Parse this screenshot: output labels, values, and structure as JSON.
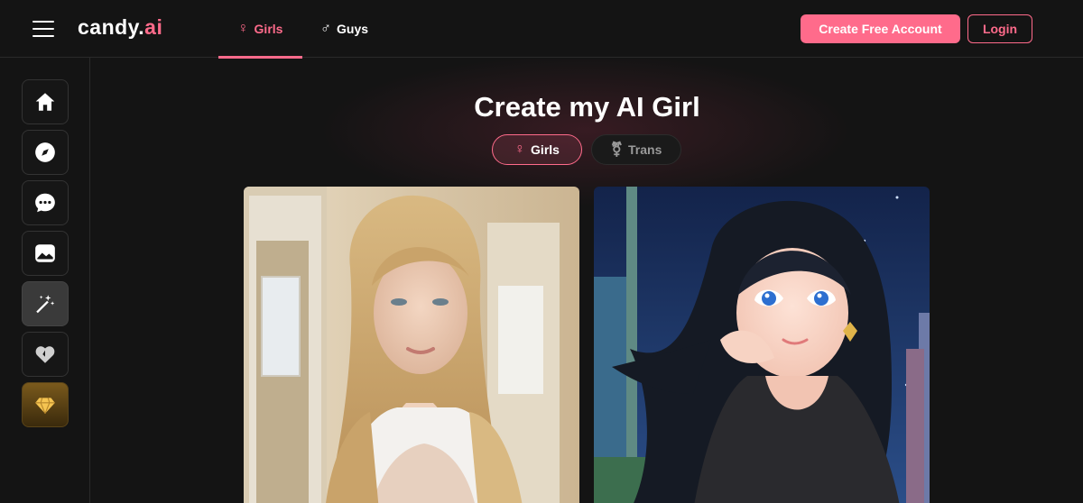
{
  "header": {
    "logo_prefix": "candy.",
    "logo_suffix": "ai",
    "tabs": [
      {
        "label": "Girls",
        "icon": "female-icon",
        "active": true
      },
      {
        "label": "Guys",
        "icon": "male-icon",
        "active": false
      }
    ],
    "create_account_label": "Create Free Account",
    "login_label": "Login",
    "accent_color": "#ff6b8b"
  },
  "sidebar": {
    "items": [
      {
        "name": "home",
        "icon": "home-icon"
      },
      {
        "name": "explore",
        "icon": "compass-icon"
      },
      {
        "name": "chat",
        "icon": "chat-bubble-icon"
      },
      {
        "name": "gallery",
        "icon": "image-icon"
      },
      {
        "name": "create",
        "icon": "magic-wand-icon",
        "active": true
      },
      {
        "name": "my-ai",
        "icon": "heart-icon"
      },
      {
        "name": "premium",
        "icon": "diamond-icon"
      }
    ]
  },
  "main": {
    "title": "Create my AI Girl",
    "gender_options": [
      {
        "label": "Girls",
        "icon": "female-icon",
        "selected": true
      },
      {
        "label": "Trans",
        "icon": "transgender-icon",
        "selected": false
      }
    ],
    "style_cards": [
      {
        "style": "realistic",
        "image": "blonde-woman-photo"
      },
      {
        "style": "anime",
        "image": "anime-dark-hair-woman"
      }
    ]
  }
}
